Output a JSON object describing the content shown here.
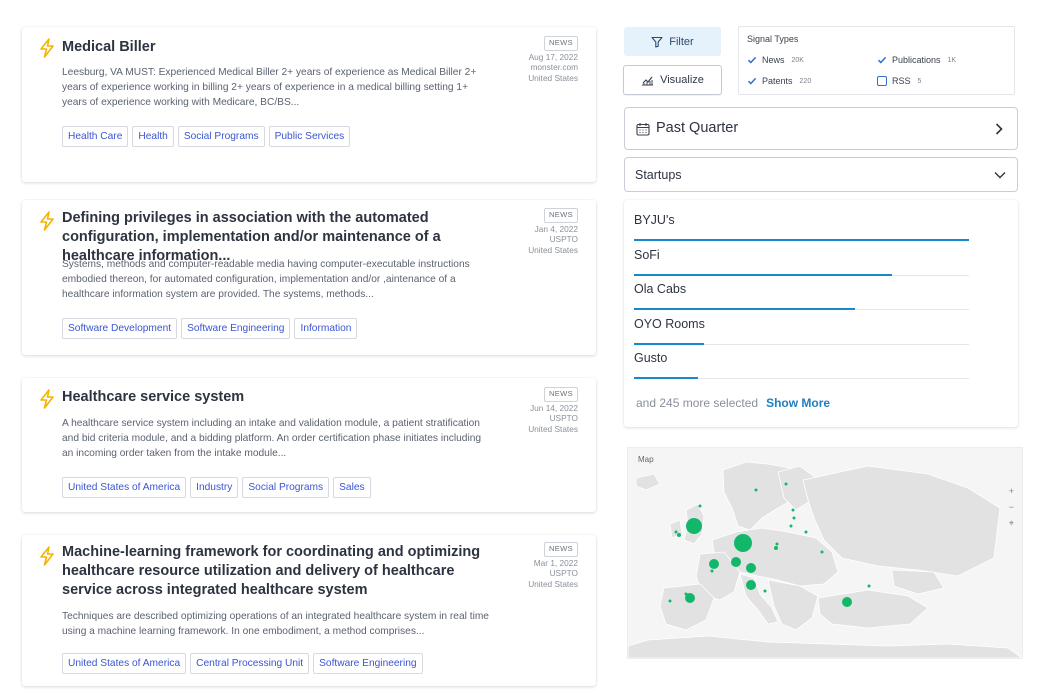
{
  "feed": [
    {
      "title": "Medical Biller",
      "description": "Leesburg, VA MUST: Experienced Medical Biller 2+ years of experience as Medical Biller 2+ years of experience working in billing 2+ years of experience in a medical billing setting 1+ years of experience working with Medicare, BC/BS...",
      "type": "NEWS",
      "date": "Aug 17, 2022",
      "source": "monster.com",
      "country": "United States",
      "tags": [
        "Health Care",
        "Health",
        "Social Programs",
        "Public Services"
      ]
    },
    {
      "title": "Defining privileges in association with the automated configuration, implementation and/or maintenance of a healthcare information...",
      "description": "Systems, methods and computer-readable media having computer-executable instructions embodied thereon, for automated configuration, implementation and/or ,aintenance of a healthcare information system are provided. The systems, methods...",
      "type": "NEWS",
      "date": "Jan 4, 2022",
      "source": "USPTO",
      "country": "United States",
      "tags": [
        "Software Development",
        "Software Engineering",
        "Information"
      ]
    },
    {
      "title": "Healthcare service system",
      "description": "A healthcare service system including an intake and validation module, a patient stratification and bid criteria module, and a bidding platform. An order certification phase initiates including an incoming order taken from the intake module...",
      "type": "NEWS",
      "date": "Jun 14, 2022",
      "source": "USPTO",
      "country": "United States",
      "tags": [
        "United States of America",
        "Industry",
        "Social Programs",
        "Sales"
      ]
    },
    {
      "title": "Machine-learning framework for coordinating and optimizing healthcare resource utilization and delivery of healthcare service across integrated healthcare system",
      "description": "Techniques are described optimizing operations of an integrated healthcare system in real time using a machine learning framework. In one embodiment, a method comprises...",
      "type": "NEWS",
      "date": "Mar 1, 2022",
      "source": "USPTO",
      "country": "United States",
      "tags": [
        "United States of America",
        "Central Processing Unit",
        "Software Engineering"
      ]
    }
  ],
  "toolbar": {
    "filter_label": "Filter",
    "visualize_label": "Visualize"
  },
  "signal_types": {
    "title": "Signal Types",
    "items": [
      {
        "label": "News",
        "count": "20K",
        "checked": true
      },
      {
        "label": "Publications",
        "count": "1K",
        "checked": true
      },
      {
        "label": "Patents",
        "count": "220",
        "checked": true
      },
      {
        "label": "RSS",
        "count": "5",
        "checked": false
      }
    ]
  },
  "period_select": {
    "label": "Past Quarter",
    "icon": "calendar-icon"
  },
  "category_select": {
    "label": "Startups",
    "icon": "chevron-down-icon"
  },
  "startups": {
    "items": [
      {
        "name": "BYJU's",
        "level": 1.0
      },
      {
        "name": "SoFi",
        "level": 0.77
      },
      {
        "name": "Ola Cabs",
        "level": 0.66
      },
      {
        "name": "OYO Rooms",
        "level": 0.21
      },
      {
        "name": "Gusto",
        "level": 0.19
      }
    ],
    "more_text": "and 245 more selected",
    "show_more_label": "Show More"
  },
  "map": {
    "title": "Map",
    "zoom_in": "+",
    "zoom_out": "−",
    "reset": "⌖",
    "marker_color": "#12b76a"
  },
  "colors": {
    "accent": "#1a87c9",
    "tag_text": "#3b55d0",
    "bolt": "#f5b400"
  }
}
